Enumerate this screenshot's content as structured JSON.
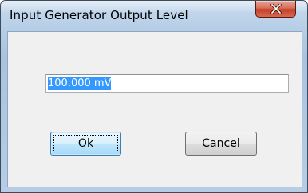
{
  "dialog": {
    "title": "Input Generator Output Level",
    "close_icon": "close-icon",
    "input_value": "100.000 mV",
    "ok_label": "Ok",
    "cancel_label": "Cancel"
  }
}
